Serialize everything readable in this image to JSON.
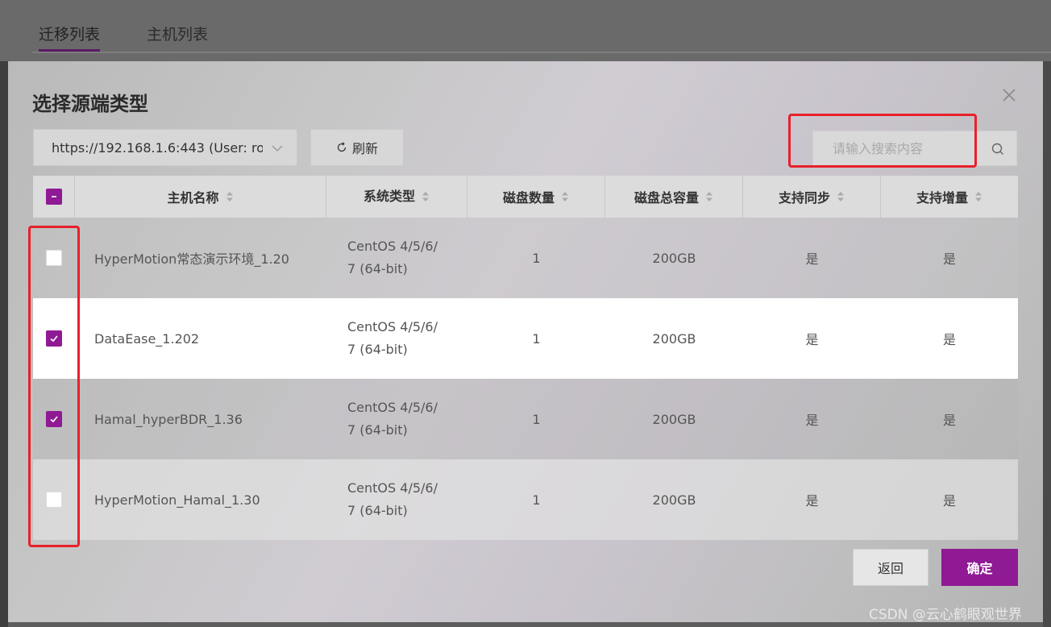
{
  "bg_tabs": [
    {
      "label": "迁移列表",
      "active": true
    },
    {
      "label": "主机列表",
      "active": false
    }
  ],
  "modal": {
    "title": "选择源端类型",
    "source_select": "https://192.168.1.6:443 (User: ro",
    "refresh_label": "刷新",
    "search_placeholder": "请输入搜索内容",
    "back_label": "返回",
    "confirm_label": "确定"
  },
  "table": {
    "headers": [
      "主机名称",
      "系统类型",
      "磁盘数量",
      "磁盘总容量",
      "支持同步",
      "支持增量"
    ],
    "rows": [
      {
        "name": "HyperMotion常态演示环境_1.20",
        "os_line1": "CentOS 4/5/6/",
        "os_line2": "7 (64-bit)",
        "disks": "1",
        "capacity": "200GB",
        "sync": "是",
        "incremental": "是",
        "checked": false
      },
      {
        "name": "DataEase_1.202",
        "os_line1": "CentOS 4/5/6/",
        "os_line2": "7 (64-bit)",
        "disks": "1",
        "capacity": "200GB",
        "sync": "是",
        "incremental": "是",
        "checked": true
      },
      {
        "name": "Hamal_hyperBDR_1.36",
        "os_line1": "CentOS 4/5/6/",
        "os_line2": "7 (64-bit)",
        "disks": "1",
        "capacity": "200GB",
        "sync": "是",
        "incremental": "是",
        "checked": true
      },
      {
        "name": "HyperMotion_Hamal_1.30",
        "os_line1": "CentOS 4/5/6/",
        "os_line2": "7 (64-bit)",
        "disks": "1",
        "capacity": "200GB",
        "sync": "是",
        "incremental": "是",
        "checked": false
      }
    ]
  },
  "watermark": "CSDN @云心鹤眼观世界",
  "colors": {
    "accent": "#8f1a94",
    "annotation": "#e8202a"
  }
}
